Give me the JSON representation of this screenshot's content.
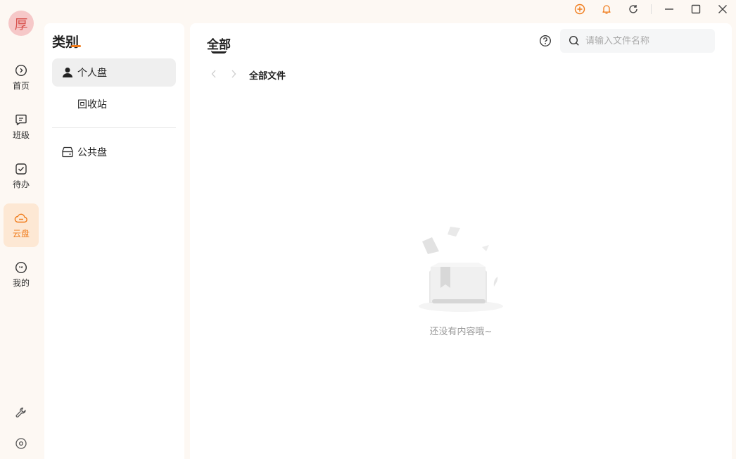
{
  "window": {
    "controls": [
      "add-icon",
      "bell-icon",
      "refresh-icon",
      "minimize-icon",
      "maximize-icon",
      "close-icon"
    ],
    "accent": "#f07b1a"
  },
  "user": {
    "avatar_char": "厚"
  },
  "rail": {
    "items": [
      {
        "label": "首页",
        "icon": "home-icon"
      },
      {
        "label": "班级",
        "icon": "chat-icon"
      },
      {
        "label": "待办",
        "icon": "todo-check-icon"
      },
      {
        "label": "云盘",
        "icon": "cloud-icon",
        "active": true
      },
      {
        "label": "我的",
        "icon": "face-icon"
      }
    ],
    "bottom": [
      "wrench-icon",
      "settings-icon"
    ]
  },
  "categories": {
    "title": "类别",
    "items": [
      {
        "label": "个人盘",
        "icon": "person-icon",
        "active": true
      },
      {
        "label": "回收站"
      },
      {
        "label": "公共盘",
        "icon": "drive-icon"
      }
    ]
  },
  "main": {
    "tab": "全部",
    "search_placeholder": "请输入文件名称",
    "breadcrumb": "全部文件",
    "empty_text": "还没有内容哦~"
  }
}
